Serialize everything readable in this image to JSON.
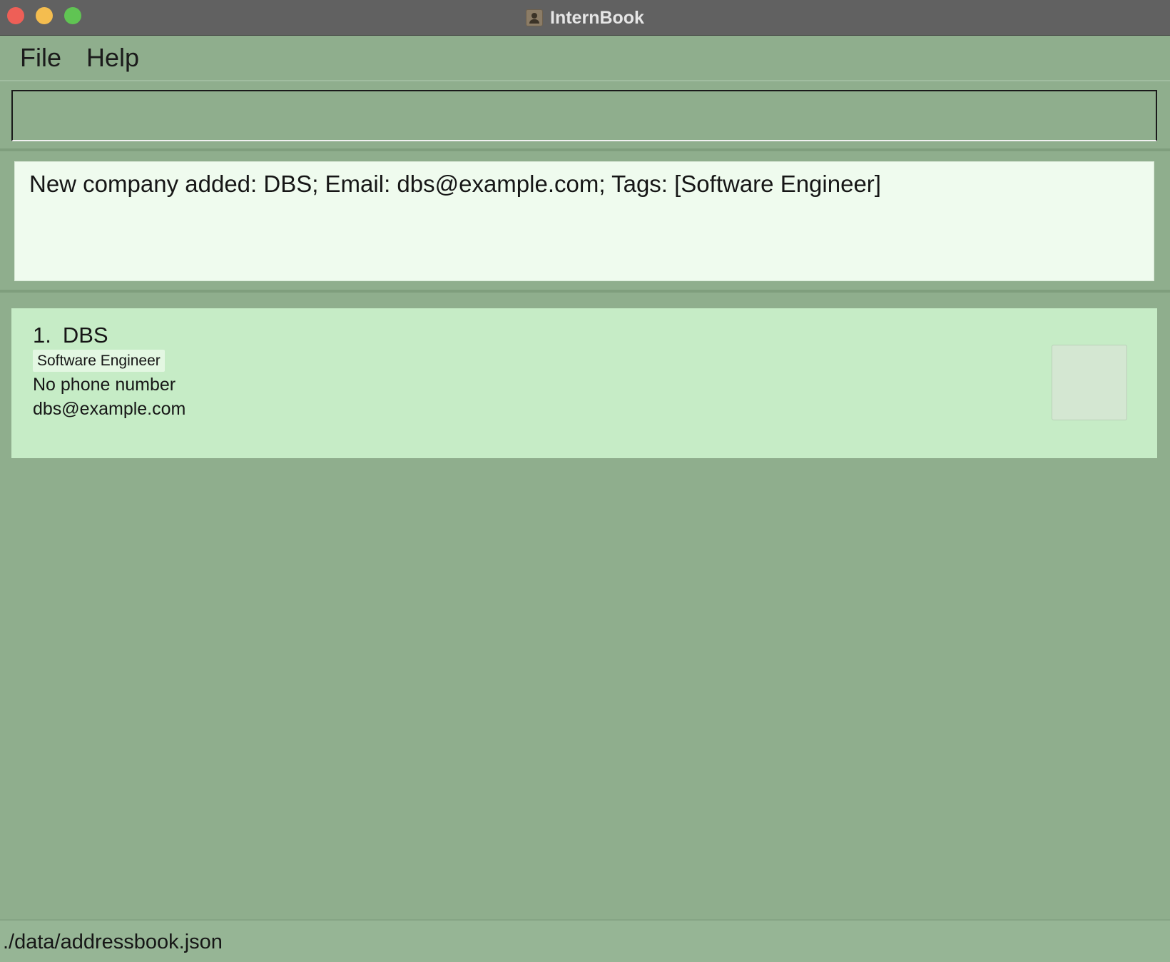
{
  "window": {
    "title": "InternBook",
    "app_icon": "contact-book-icon"
  },
  "menu": {
    "file_label": "File",
    "help_label": "Help"
  },
  "command": {
    "value": "",
    "placeholder": ""
  },
  "result": {
    "message": "New company added: DBS; Email: dbs@example.com; Tags: [Software Engineer]"
  },
  "companies": [
    {
      "index": "1.",
      "name": "DBS",
      "tags": [
        "Software Engineer"
      ],
      "phone": "No phone number",
      "email": "dbs@example.com"
    }
  ],
  "status": {
    "file_path": "./data/addressbook.json"
  },
  "colors": {
    "background": "#8fae8d",
    "titlebar": "#616161",
    "result_panel": "#effbee",
    "card": "#c6ecc6",
    "tag": "#e3f7e2",
    "close": "#ee5f57",
    "minimize": "#f4bd4f",
    "maximize": "#60c453"
  }
}
